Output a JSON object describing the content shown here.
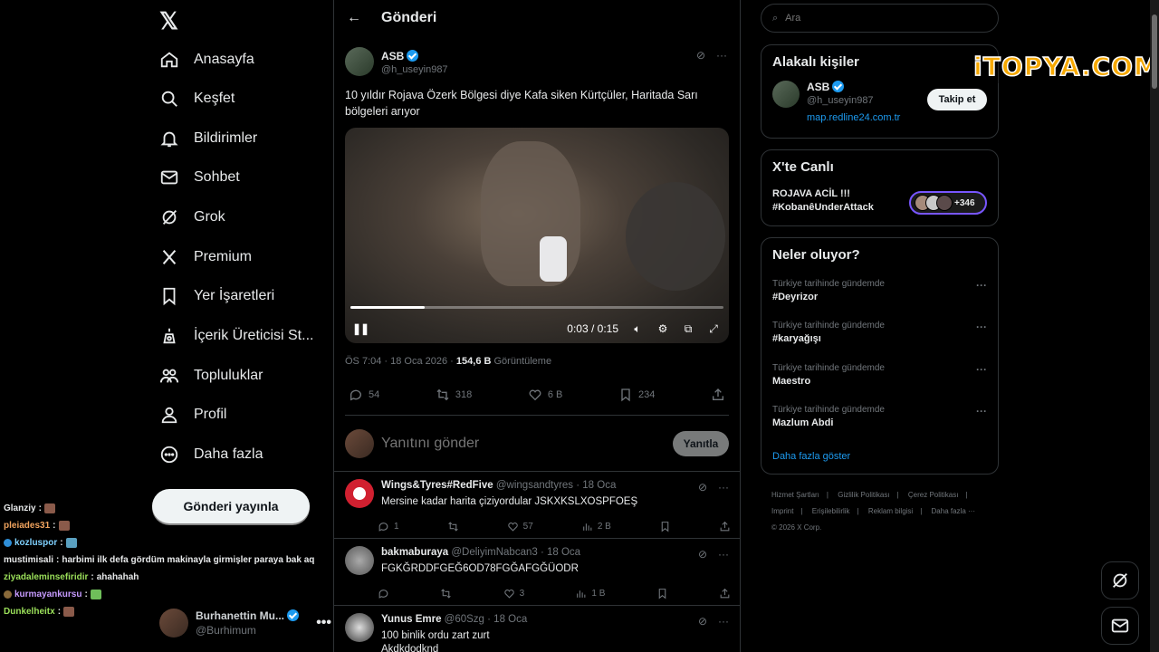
{
  "nav": {
    "items": [
      {
        "label": "Anasayfa",
        "icon": "home-icon"
      },
      {
        "label": "Keşfet",
        "icon": "search-icon"
      },
      {
        "label": "Bildirimler",
        "icon": "bell-icon"
      },
      {
        "label": "Sohbet",
        "icon": "mail-icon"
      },
      {
        "label": "Grok",
        "icon": "grok-icon"
      },
      {
        "label": "Premium",
        "icon": "x-premium-icon"
      },
      {
        "label": "Yer İşaretleri",
        "icon": "bookmark-icon"
      },
      {
        "label": "İçerik Üreticisi St...",
        "icon": "creator-studio-icon"
      },
      {
        "label": "Topluluklar",
        "icon": "communities-icon"
      },
      {
        "label": "Profil",
        "icon": "profile-icon"
      },
      {
        "label": "Daha fazla",
        "icon": "more-circle-icon"
      }
    ],
    "post_button": "Gönderi yayınla",
    "account": {
      "name": "Burhanettin Mu...",
      "handle": "@Burhimum",
      "more": "•••"
    }
  },
  "chat": [
    {
      "user": "Glanziy",
      "text": "",
      "color": "#e7e9ea"
    },
    {
      "user": "pleiades31",
      "text": "",
      "color": "#f0a35e"
    },
    {
      "user": "kozluspor",
      "text": "",
      "color": "#7fd1ff"
    },
    {
      "user": "mustimisali",
      "text": "harbimi ilk defa gördüm makinayla girmişler paraya bak aq",
      "color": "#e7e9ea"
    },
    {
      "user": "ziyadaleminsefiridir",
      "text": "ahahahah",
      "color": "#9be05a"
    },
    {
      "user": "kurmayankursu",
      "text": "",
      "color": "#c79bff"
    },
    {
      "user": "Dunkelheitx",
      "text": "",
      "color": "#9be05a"
    }
  ],
  "main": {
    "header": "Gönderi",
    "tweet": {
      "name": "ASB",
      "handle": "@h_useyin987",
      "text": "10 yıldır Rojava Özerk Bölgesi diye Kafa siken Kürtçüler, Haritada Sarı bölgeleri arıyor",
      "video_time": "0:03 / 0:15",
      "video_progress": 0.2,
      "meta_time": "ÖS 7:04 · 18 Oca 2026 · ",
      "views": "154,6 B",
      "views_label": " Görüntüleme",
      "replies": "54",
      "retweets": "318",
      "likes": "6 B",
      "bookmarks": "234"
    },
    "reply_box": {
      "placeholder": "Yanıtını gönder",
      "button": "Yanıtla"
    },
    "replies": [
      {
        "name": "Wings&Tyres#RedFive",
        "handle": "@wingsandtyres · 18 Oca",
        "text": "Mersine kadar harita çiziyordular JSKXKSLXOSPFOEŞ",
        "replies": "1",
        "retweets": "",
        "likes": "57",
        "views": "2 B"
      },
      {
        "name": "bakmaburaya",
        "handle": "@DeliyimNabcan3 · 18 Oca",
        "text": "FGKĞRDDFGEĞ6OD78FGĞAFGĞÜODR",
        "replies": "",
        "retweets": "",
        "likes": "3",
        "views": "1 B"
      },
      {
        "name": "Yunus Emre",
        "handle": "@60Szg · 18 Oca",
        "text": "100 binlik ordu zart zurt\nAkdkdodknd",
        "replies": "",
        "retweets": "",
        "likes": "",
        "views": ""
      }
    ]
  },
  "right": {
    "search_placeholder": "Ara",
    "related": {
      "title": "Alakalı kişiler",
      "name": "ASB",
      "handle": "@h_useyin987",
      "link": "map.redline24.com.tr",
      "follow": "Takip et"
    },
    "live": {
      "title": "X'te Canlı",
      "line1": "ROJAVA ACİL !!!",
      "line2": "#KobanêUnderAttack",
      "count": "+346"
    },
    "trends": {
      "title": "Neler oluyor?",
      "items": [
        {
          "sub": "Türkiye tarihinde gündemde",
          "name": "#Deyrizor"
        },
        {
          "sub": "Türkiye tarihinde gündemde",
          "name": "#karyağışı"
        },
        {
          "sub": "Türkiye tarihinde gündemde",
          "name": "Maestro"
        },
        {
          "sub": "Türkiye tarihinde gündemde",
          "name": "Mazlum Abdi"
        }
      ],
      "show_more": "Daha fazla göster"
    },
    "footer": [
      "Hizmet Şartları",
      "|",
      "Gizlilik Politikası",
      "|",
      "Çerez Politikası",
      "|",
      "Imprint",
      "|",
      "Erişilebilirlik",
      "|",
      "Reklam bilgisi",
      "|",
      "Daha fazla ···",
      "© 2026 X Corp."
    ]
  },
  "brand": "iTOPYA.COM",
  "colors": {
    "accent": "#1d9bf0",
    "live_border": "#7856ff",
    "brand": "#f6a800"
  }
}
